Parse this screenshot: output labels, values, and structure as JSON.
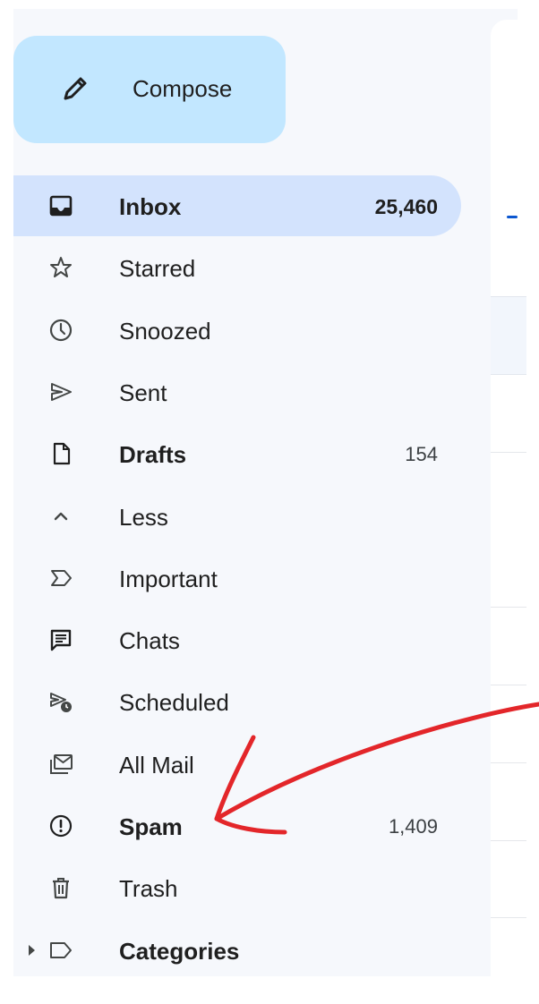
{
  "compose": {
    "label": "Compose",
    "icon": "pencil-icon"
  },
  "nav": [
    {
      "label": "Inbox",
      "count": "25,460",
      "icon": "inbox-icon",
      "bold": true,
      "active": true
    },
    {
      "label": "Starred",
      "count": "",
      "icon": "star-icon",
      "bold": false,
      "active": false
    },
    {
      "label": "Snoozed",
      "count": "",
      "icon": "clock-icon",
      "bold": false,
      "active": false
    },
    {
      "label": "Sent",
      "count": "",
      "icon": "send-icon",
      "bold": false,
      "active": false
    },
    {
      "label": "Drafts",
      "count": "154",
      "icon": "draft-icon",
      "bold": true,
      "active": false
    },
    {
      "label": "Less",
      "count": "",
      "icon": "chevron-up-icon",
      "bold": false,
      "active": false
    },
    {
      "label": "Important",
      "count": "",
      "icon": "important-icon",
      "bold": false,
      "active": false
    },
    {
      "label": "Chats",
      "count": "",
      "icon": "chat-icon",
      "bold": false,
      "active": false
    },
    {
      "label": "Scheduled",
      "count": "",
      "icon": "scheduled-icon",
      "bold": false,
      "active": false
    },
    {
      "label": "All Mail",
      "count": "",
      "icon": "all-mail-icon",
      "bold": false,
      "active": false
    },
    {
      "label": "Spam",
      "count": "1,409",
      "icon": "spam-icon",
      "bold": true,
      "active": false
    },
    {
      "label": "Trash",
      "count": "",
      "icon": "trash-icon",
      "bold": false,
      "active": false
    },
    {
      "label": "Categories",
      "count": "",
      "icon": "label-icon",
      "bold": true,
      "active": false
    }
  ],
  "colors": {
    "compose_bg": "#c2e7ff",
    "active_bg": "#d3e3fd",
    "sidebar_bg": "#f6f8fc",
    "annotation": "#e3262a"
  }
}
